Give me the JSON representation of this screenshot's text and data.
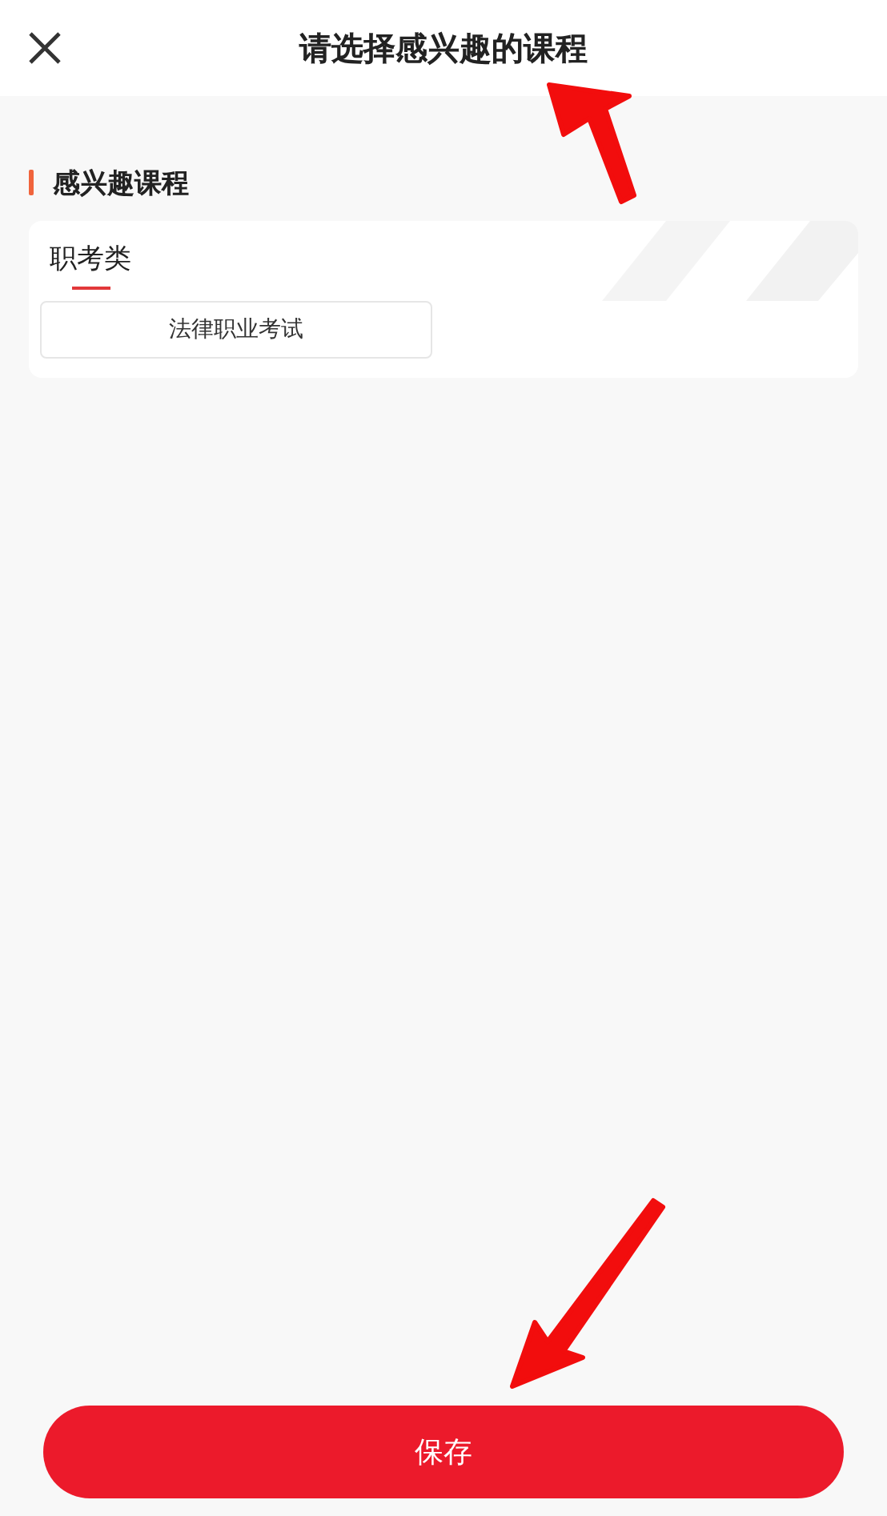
{
  "header": {
    "title": "请选择感兴趣的课程"
  },
  "section": {
    "title": "感兴趣课程"
  },
  "categories": [
    {
      "label": "职考类",
      "selected": true
    }
  ],
  "courses": [
    {
      "label": "法律职业考试"
    }
  ],
  "save_button": {
    "label": "保存"
  },
  "annotations": [
    {
      "kind": "arrow"
    },
    {
      "kind": "arrow"
    }
  ]
}
